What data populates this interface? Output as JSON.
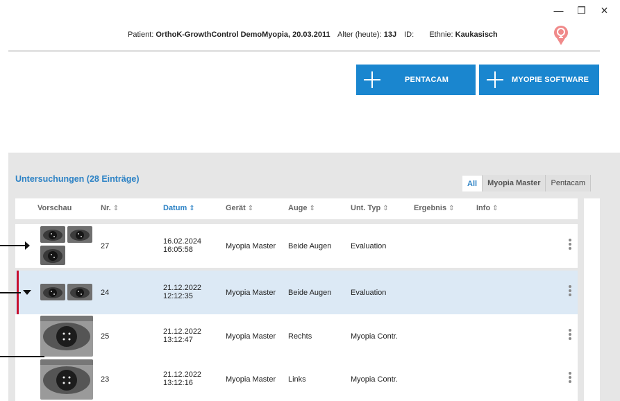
{
  "window": {
    "minimize": "—",
    "restore": "❐",
    "close": "✕"
  },
  "patient": {
    "patient_label": "Patient:",
    "patient_value": "OrthoK-GrowthControl DemoMyopia, 20.03.2011",
    "age_label": "Alter (heute):",
    "age_value": "13J",
    "id_label": "ID:",
    "id_value": "",
    "ethnicity_label": "Ethnie:",
    "ethnicity_value": "Kaukasisch",
    "gender_icon": "female-icon",
    "gender_color": "#f08a8a"
  },
  "actions": {
    "pentacam_label": "PENTACAM",
    "myopie_label": "MYOPIE SOFTWARE",
    "accent": "#1a86cf"
  },
  "exams": {
    "title": "Untersuchungen (28 Einträge)",
    "tabs": [
      {
        "label": "All",
        "active": true
      },
      {
        "label": "Myopia Master",
        "active": false
      },
      {
        "label": "Pentacam",
        "active": false
      }
    ],
    "columns": {
      "preview": "Vorschau",
      "nr": "Nr.",
      "date": "Datum",
      "device": "Gerät",
      "eye": "Auge",
      "type": "Unt. Typ",
      "result": "Ergebnis",
      "info": "Info"
    },
    "sort_icon": "⇕",
    "rows": [
      {
        "nr": "27",
        "date": "16.02.2024",
        "time": "16:05:58",
        "device": "Myopia Master",
        "eye": "Beide Augen",
        "type": "Evaluation",
        "result": "",
        "info": "",
        "expand": "collapsed"
      },
      {
        "nr": "24",
        "date": "21.12.2022",
        "time": "12:12:35",
        "device": "Myopia Master",
        "eye": "Beide Augen",
        "type": "Evaluation",
        "result": "",
        "info": "",
        "expand": "expanded",
        "selected": true
      },
      {
        "nr": "25",
        "date": "21.12.2022",
        "time": "13:12:47",
        "device": "Myopia Master",
        "eye": "Rechts",
        "type": "Myopia Contr.",
        "result": "",
        "info": ""
      },
      {
        "nr": "23",
        "date": "21.12.2022",
        "time": "13:12:16",
        "device": "Myopia Master",
        "eye": "Links",
        "type": "Myopia Contr.",
        "result": "",
        "info": ""
      }
    ],
    "selection_color": "#c8102e"
  }
}
